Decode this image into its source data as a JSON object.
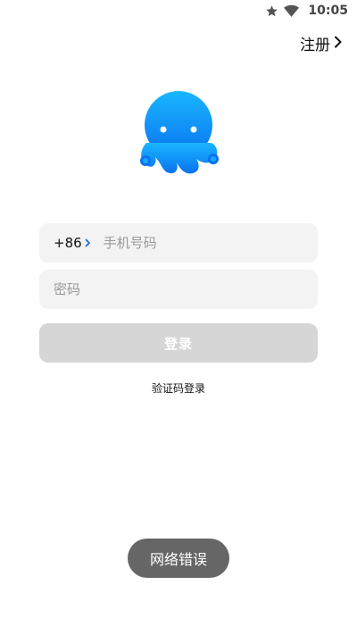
{
  "status_bar": {
    "time": "10:05",
    "icons": [
      "star-icon",
      "wifi-icon"
    ]
  },
  "header": {
    "register_label": "注册"
  },
  "form": {
    "country_code": "+86",
    "phone_placeholder": "手机号码",
    "phone_value": "",
    "password_placeholder": "密码",
    "password_value": "",
    "login_label": "登录",
    "code_login_label": "验证码登录"
  },
  "toast": {
    "message": "网络错误"
  },
  "colors": {
    "logo_blue": "#1a9cf6",
    "button_disabled": "#d6d6d6",
    "field_bg": "#f3f3f3",
    "toast_bg": "#666666",
    "accent_chevron": "#1a73c9"
  }
}
